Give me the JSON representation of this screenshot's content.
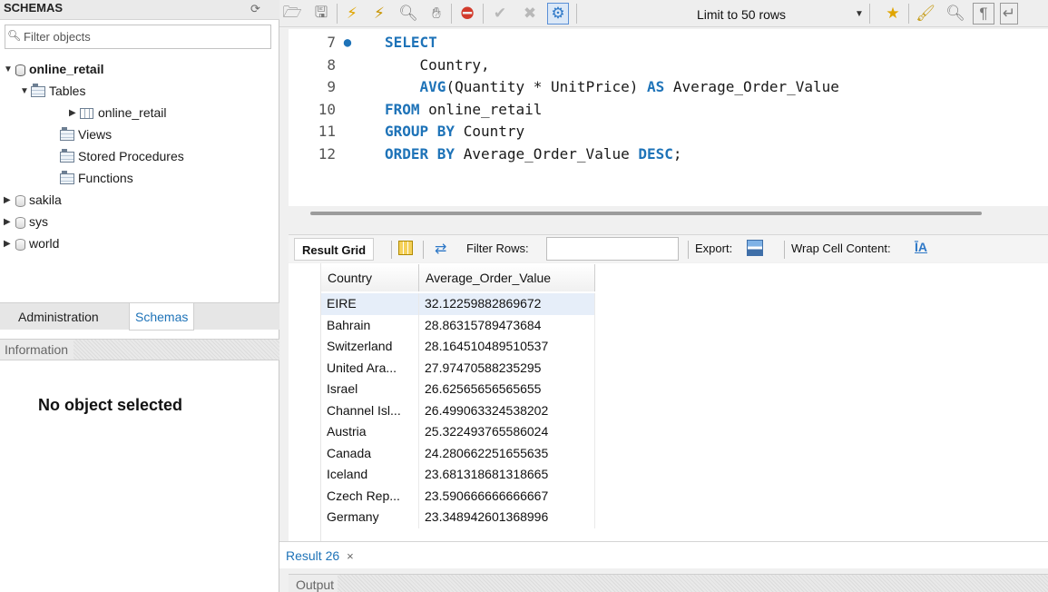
{
  "sidebar": {
    "title": "SCHEMAS",
    "filter_placeholder": "Filter objects",
    "tree": {
      "active_schema": "online_retail",
      "tables_label": "Tables",
      "table_name": "online_retail",
      "views_label": "Views",
      "procedures_label": "Stored Procedures",
      "functions_label": "Functions",
      "other_schemas": [
        "sakila",
        "sys",
        "world"
      ]
    },
    "tabs": [
      "Administration",
      "Schemas"
    ],
    "active_tab": "Schemas",
    "info_title": "Information",
    "info_message": "No object selected"
  },
  "toolbar": {
    "limit_label": "Limit to 50 rows"
  },
  "editor": {
    "lines": [
      {
        "n": "7",
        "tokens": [
          {
            "t": "SELECT",
            "kw": true
          }
        ],
        "marker": true
      },
      {
        "n": "8",
        "tokens": [
          {
            "t": "    Country,",
            "kw": false
          }
        ]
      },
      {
        "n": "9",
        "tokens": [
          {
            "t": "    AVG",
            "kw": true
          },
          {
            "t": "(Quantity * UnitPrice) ",
            "kw": false
          },
          {
            "t": "AS",
            "kw": true
          },
          {
            "t": " Average_Order_Value",
            "kw": false
          }
        ]
      },
      {
        "n": "10",
        "tokens": [
          {
            "t": "FROM",
            "kw": true
          },
          {
            "t": " online_retail",
            "kw": false
          }
        ]
      },
      {
        "n": "11",
        "tokens": [
          {
            "t": "GROUP BY",
            "kw": true
          },
          {
            "t": " Country",
            "kw": false
          }
        ]
      },
      {
        "n": "12",
        "tokens": [
          {
            "t": "ORDER BY",
            "kw": true
          },
          {
            "t": " Average_Order_Value ",
            "kw": false
          },
          {
            "t": "DESC",
            "kw": true
          },
          {
            "t": ";",
            "kw": false
          }
        ]
      }
    ]
  },
  "result_toolbar": {
    "result_grid_label": "Result Grid",
    "filter_rows_label": "Filter Rows:",
    "filter_rows_value": "",
    "export_label": "Export:",
    "wrap_label": "Wrap Cell Content:",
    "wrap_glyph": "ĪA"
  },
  "grid": {
    "columns": [
      "Country",
      "Average_Order_Value"
    ],
    "rows": [
      [
        "EIRE",
        "32.12259882869672"
      ],
      [
        "Bahrain",
        "28.86315789473684"
      ],
      [
        "Switzerland",
        "28.164510489510537"
      ],
      [
        "United Ara...",
        "27.97470588235295"
      ],
      [
        "Israel",
        "26.62565656565655"
      ],
      [
        "Channel Isl...",
        "26.499063324538202"
      ],
      [
        "Austria",
        "25.322493765586024"
      ],
      [
        "Canada",
        "24.280662251655635"
      ],
      [
        "Iceland",
        "23.681318681318665"
      ],
      [
        "Czech Rep...",
        "23.590666666666667"
      ],
      [
        "Germany",
        "23.348942601368996"
      ]
    ]
  },
  "result_tab": {
    "label": "Result 26",
    "close": "×"
  },
  "output": {
    "title": "Output"
  }
}
